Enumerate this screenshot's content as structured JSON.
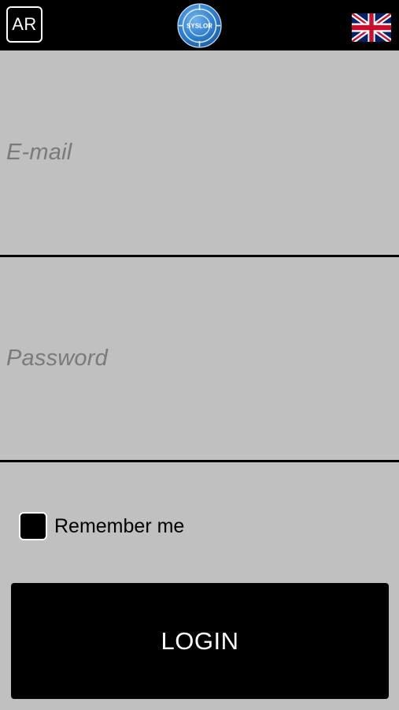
{
  "header": {
    "ar_label": "AR",
    "logo_text": "SYSLOR",
    "language_flag": "uk-flag-icon"
  },
  "form": {
    "email_placeholder": "E-mail",
    "password_placeholder": "Password",
    "remember_label": "Remember me",
    "remember_checked": false,
    "login_label": "LOGIN"
  },
  "colors": {
    "background": "#c0c0c0",
    "topbar": "#000000",
    "button": "#000000",
    "placeholder": "#7a7a7a",
    "logo_blue": "#2f7fd1"
  }
}
